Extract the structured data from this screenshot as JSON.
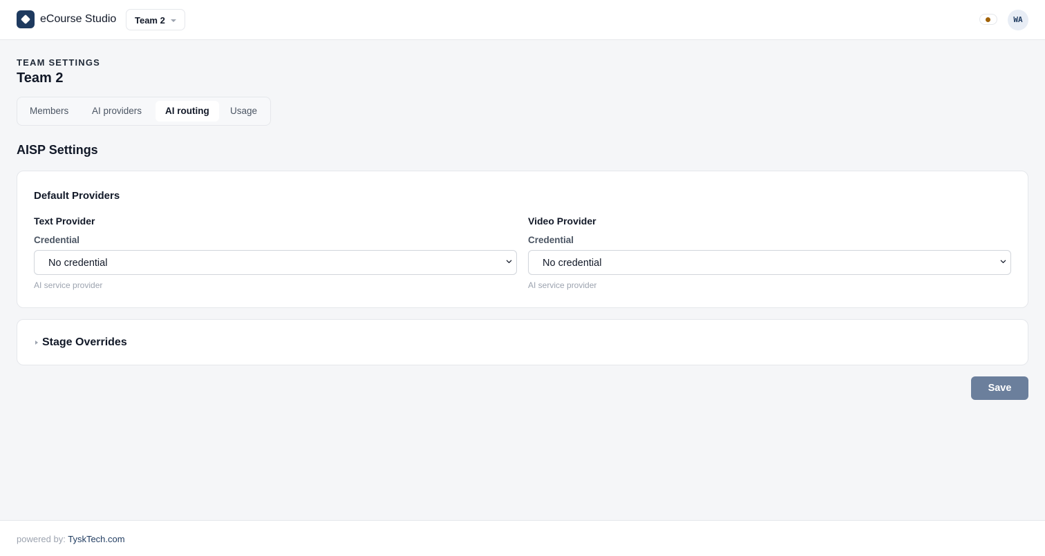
{
  "header": {
    "app_title": "eCourse Studio",
    "team_selector": "Team 2",
    "avatar_initials": "WA",
    "status_dot_color": "#a16207",
    "brand_color": "#1e3a5f"
  },
  "page": {
    "eyebrow": "TEAM SETTINGS",
    "title": "Team 2"
  },
  "tabs": [
    {
      "label": "Members",
      "active": false
    },
    {
      "label": "AI providers",
      "active": false
    },
    {
      "label": "AI routing",
      "active": true
    },
    {
      "label": "Usage",
      "active": false
    }
  ],
  "section": {
    "title": "AISP Settings"
  },
  "default_providers": {
    "title": "Default Providers",
    "text_provider": {
      "title": "Text Provider",
      "field_label": "Credential",
      "selected": "No credential",
      "hint": "AI service provider"
    },
    "video_provider": {
      "title": "Video Provider",
      "field_label": "Credential",
      "selected": "No credential",
      "hint": "AI service provider"
    }
  },
  "stage_overrides": {
    "title": "Stage Overrides",
    "expanded": false
  },
  "actions": {
    "save_label": "Save",
    "save_color": "#6b7f9c"
  },
  "footer": {
    "prefix": "powered by:",
    "link_text": "TyskTech.com"
  }
}
